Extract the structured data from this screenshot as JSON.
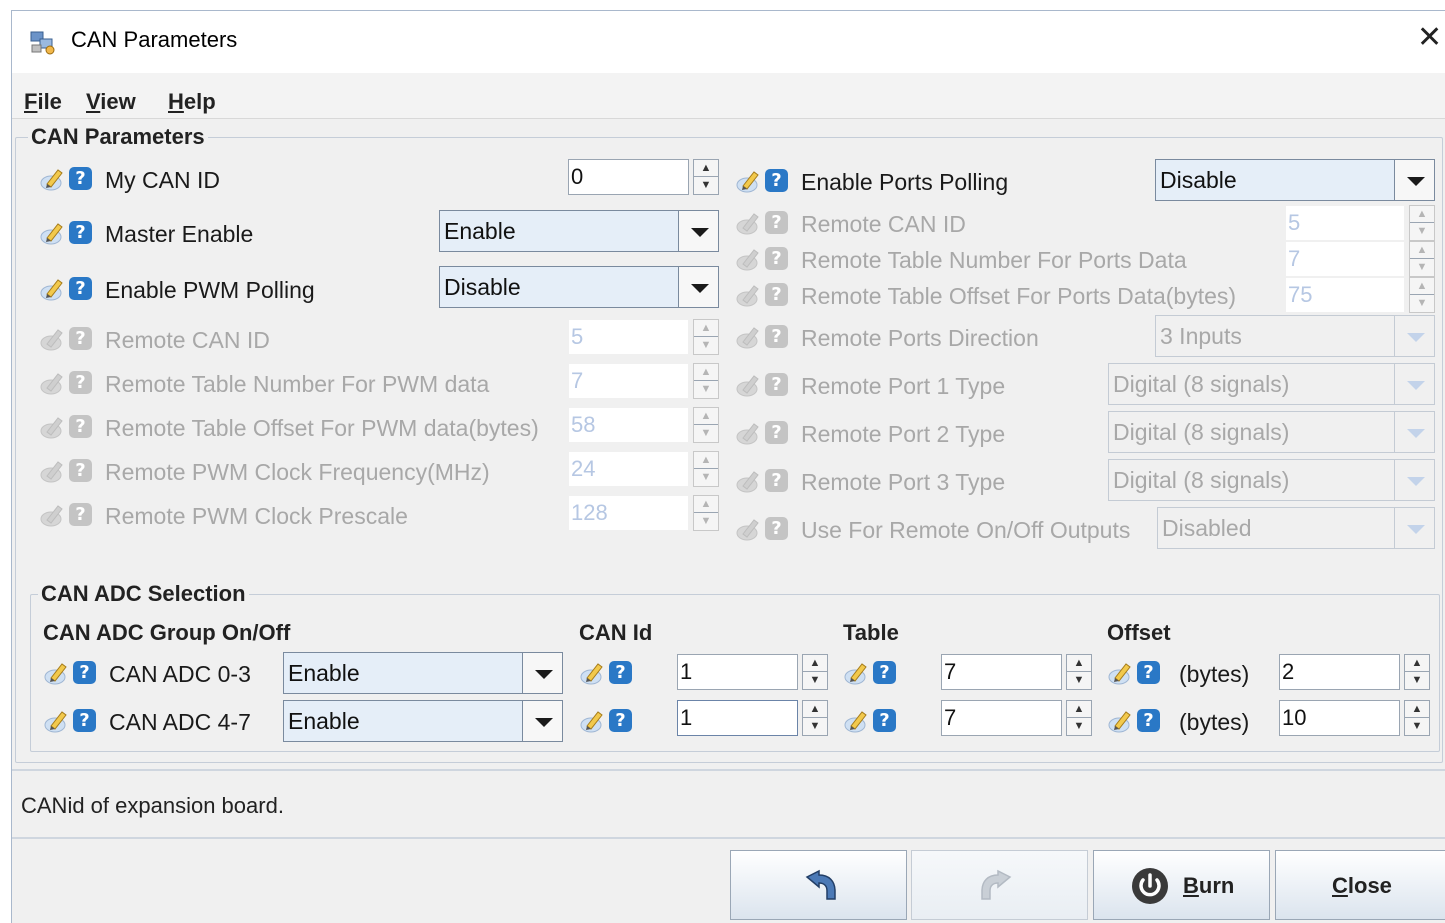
{
  "window": {
    "title": "CAN Parameters"
  },
  "menu": [
    {
      "accel": "F",
      "rest": "ile"
    },
    {
      "accel": "V",
      "rest": "iew"
    },
    {
      "accel": "H",
      "rest": "elp"
    }
  ],
  "params_group": {
    "title": "CAN Parameters",
    "my_can_id": {
      "label": "My CAN ID",
      "value": "0"
    },
    "master_enable": {
      "label": "Master Enable",
      "value": "Enable"
    },
    "enable_pwm_polling": {
      "label": "Enable PWM Polling",
      "value": "Disable"
    },
    "pwm_remote_can_id": {
      "label": "Remote CAN ID",
      "value": "5"
    },
    "pwm_table_number": {
      "label": "Remote Table Number For PWM data",
      "value": "7"
    },
    "pwm_table_offset": {
      "label": "Remote Table Offset For PWM data(bytes)",
      "value": "58"
    },
    "pwm_clock_freq": {
      "label": "Remote PWM Clock Frequency(MHz)",
      "value": "24"
    },
    "pwm_clock_prescale": {
      "label": "Remote PWM Clock Prescale",
      "value": "128"
    },
    "enable_ports_polling": {
      "label": "Enable Ports Polling",
      "value": "Disable"
    },
    "ports_remote_can_id": {
      "label": "Remote CAN ID",
      "value": "5"
    },
    "ports_table_number": {
      "label": "Remote Table Number For Ports Data",
      "value": "7"
    },
    "ports_table_offset": {
      "label": "Remote Table Offset For Ports Data(bytes)",
      "value": "75"
    },
    "ports_direction": {
      "label": "Remote Ports Direction",
      "value": "3 Inputs"
    },
    "port1_type": {
      "label": "Remote Port 1 Type",
      "value": "Digital (8 signals)"
    },
    "port2_type": {
      "label": "Remote Port 2 Type",
      "value": "Digital (8 signals)"
    },
    "port3_type": {
      "label": "Remote Port 3 Type",
      "value": "Digital (8 signals)"
    },
    "remote_onoff": {
      "label": "Use For Remote On/Off Outputs",
      "value": "Disabled"
    }
  },
  "adc_group": {
    "title": "CAN ADC Selection",
    "headers": {
      "group": "CAN ADC Group On/Off",
      "can_id": "CAN Id",
      "table": "Table",
      "offset": "Offset"
    },
    "rows": [
      {
        "label": "CAN ADC 0-3",
        "enable": "Enable",
        "can_id": "1",
        "table": "7",
        "offset_label": "(bytes)",
        "offset": "2"
      },
      {
        "label": "CAN ADC 4-7",
        "enable": "Enable",
        "can_id": "1",
        "table": "7",
        "offset_label": "(bytes)",
        "offset": "10"
      }
    ]
  },
  "status": {
    "text": "CANid of expansion board."
  },
  "buttons": {
    "burn": {
      "accel": "B",
      "rest": "urn"
    },
    "close": {
      "accel": "C",
      "rest": "lose"
    }
  },
  "icons": {
    "app": "network-config-icon",
    "pencil": "pencil-icon",
    "help": "help-question-icon",
    "undo": "undo-arrow-icon",
    "redo": "redo-arrow-icon",
    "burn": "power-icon"
  },
  "colors": {
    "help_icon": "#2a78c6",
    "disabled_text": "#a8a8a8",
    "disabled_value": "#b6c7e3",
    "combo_bg": "#e5eef8"
  }
}
